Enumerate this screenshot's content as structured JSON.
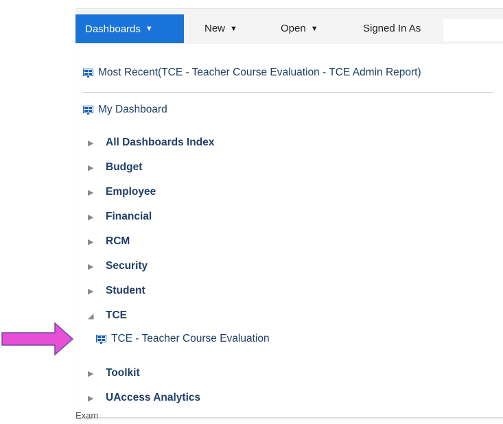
{
  "toolbar": {
    "dashboards_label": "Dashboards",
    "new_label": "New",
    "open_label": "Open",
    "signed_in_label": "Signed In As"
  },
  "menu": {
    "most_recent": "Most Recent(TCE - Teacher Course Evaluation - TCE Admin Report)",
    "my_dashboard": "My Dashboard",
    "categories": [
      {
        "label": "All Dashboards Index",
        "expanded": false
      },
      {
        "label": "Budget",
        "expanded": false
      },
      {
        "label": "Employee",
        "expanded": false
      },
      {
        "label": "Financial",
        "expanded": false
      },
      {
        "label": "RCM",
        "expanded": false
      },
      {
        "label": "Security",
        "expanded": false
      },
      {
        "label": "Student",
        "expanded": false
      },
      {
        "label": "TCE",
        "expanded": true
      },
      {
        "label": "Toolkit",
        "expanded": false
      },
      {
        "label": "UAccess Analytics",
        "expanded": false
      }
    ],
    "tce_children": [
      "TCE - Teacher Course Evaluation"
    ]
  },
  "footer_text": "Exam",
  "colors": {
    "accent": "#1a73d9",
    "link": "#1f3f66",
    "arrow": "#e84fd8",
    "icon": "#1a5fb0"
  }
}
